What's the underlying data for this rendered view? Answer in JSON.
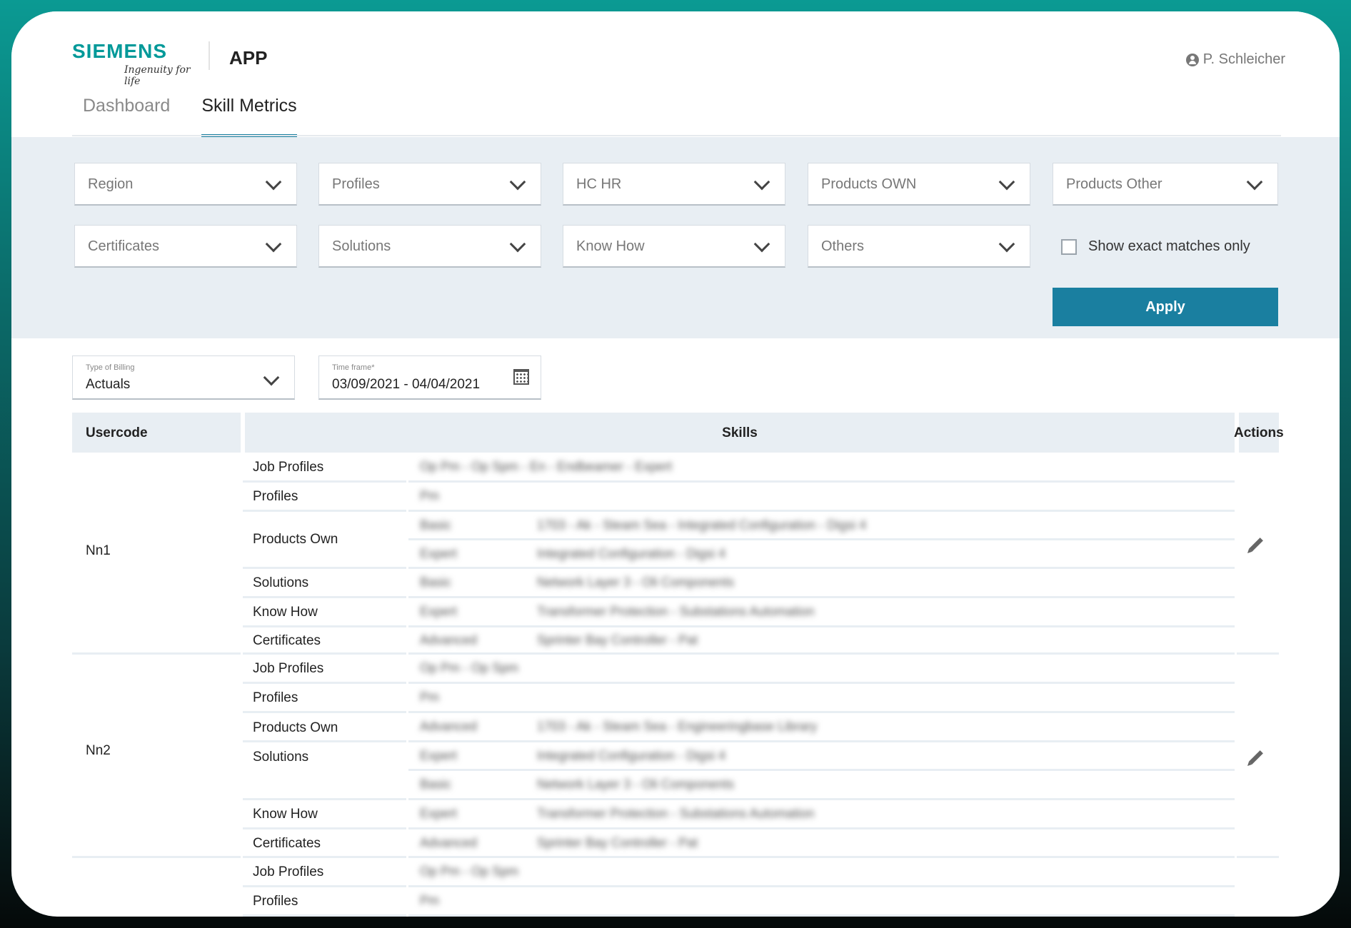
{
  "brand": {
    "name": "SIEMENS",
    "tagline": "Ingenuity for life"
  },
  "app_title": "APP",
  "user": {
    "name": "P. Schleicher",
    "icon": "user-circle-icon"
  },
  "tabs": [
    {
      "label": "Dashboard",
      "active": false
    },
    {
      "label": "Skill Metrics",
      "active": true
    }
  ],
  "filters": {
    "region": "Region",
    "profiles": "Profiles",
    "hc_hr": "HC HR",
    "products_own": "Products OWN",
    "products_other": "Products Other",
    "certificates": "Certificates",
    "solutions": "Solutions",
    "know_how": "Know How",
    "others": "Others",
    "exact_matches_label": "Show exact matches only",
    "exact_matches_checked": false,
    "apply_label": "Apply"
  },
  "billing": {
    "caption": "Type of Billing",
    "value": "Actuals"
  },
  "timeframe": {
    "caption": "Time frame*",
    "value": "03/09/2021 - 04/04/2021"
  },
  "table": {
    "headers": {
      "usercode": "Usercode",
      "skills": "Skills",
      "actions": "Actions"
    },
    "rows": [
      {
        "usercode": "Nn1",
        "categories": [
          "Job Profiles",
          "Profiles",
          "Products Own",
          "Solutions",
          "Know How",
          "Certificates"
        ],
        "skills": [
          {
            "level": "Op Pm - Op Spm - En - Endbeamer - Expert",
            "text": ""
          },
          {
            "level": "Pm",
            "text": ""
          },
          {
            "level": "Basic",
            "text": "1703 - Ak - Steam Sea - Integrated Configuration - Digsi 4"
          },
          {
            "level": "Expert",
            "text": "Integrated Configuration - Digsi 4"
          },
          {
            "level": "Basic",
            "text": "Network Layer 3 - Oli Components"
          },
          {
            "level": "Expert",
            "text": "Transformer Protection - Substations Automation"
          },
          {
            "level": "Advanced",
            "text": "Sprinter Bay Controller - Pat"
          }
        ]
      },
      {
        "usercode": "Nn2",
        "categories": [
          "Job Profiles",
          "Profiles",
          "Products Own",
          "Solutions",
          "Know How",
          "Certificates"
        ],
        "skills": [
          {
            "level": "Op Pm - Op Spm",
            "text": ""
          },
          {
            "level": "Pm",
            "text": ""
          },
          {
            "level": "Advanced",
            "text": "1703 - Ak - Steam Sea - Engineeringbase Library"
          },
          {
            "level": "Expert",
            "text": "Integrated Configuration - Digsi 4"
          },
          {
            "level": "Basic",
            "text": "Network Layer 3 - Oli Components"
          },
          {
            "level": "Expert",
            "text": "Transformer Protection - Substations Automation"
          },
          {
            "level": "Advanced",
            "text": "Sprinter Bay Controller - Pat"
          }
        ]
      },
      {
        "usercode": "",
        "categories": [
          "Job Profiles",
          "Profiles"
        ],
        "skills": [
          {
            "level": "Op Pm - Op Spm",
            "text": ""
          },
          {
            "level": "Pm",
            "text": ""
          }
        ]
      }
    ]
  },
  "colors": {
    "accent": "#1a7fa0",
    "brand": "#009999",
    "panel": "#e8eef3"
  }
}
